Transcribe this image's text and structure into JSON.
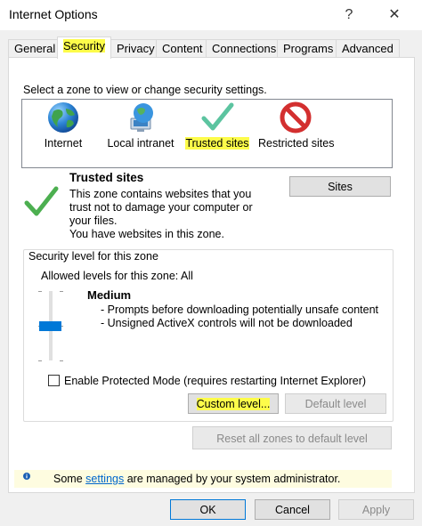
{
  "window": {
    "title": "Internet Options",
    "help_glyph": "?",
    "close_glyph": "✕"
  },
  "tabs": [
    {
      "label": "General"
    },
    {
      "label": "Security"
    },
    {
      "label": "Privacy"
    },
    {
      "label": "Content"
    },
    {
      "label": "Connections"
    },
    {
      "label": "Programs"
    },
    {
      "label": "Advanced"
    }
  ],
  "security": {
    "zone_prompt": "Select a zone to view or change security settings.",
    "zones": [
      {
        "label": "Internet",
        "icon": "globe-icon"
      },
      {
        "label": "Local intranet",
        "icon": "intranet-icon"
      },
      {
        "label": "Trusted sites",
        "icon": "checkmark-icon"
      },
      {
        "label": "Restricted sites",
        "icon": "restricted-icon"
      }
    ],
    "selected_zone": {
      "title": "Trusted sites",
      "description_lines": [
        "This zone contains websites that you",
        "trust not to damage your computer or",
        "your files.",
        "You have websites in this zone."
      ],
      "sites_button": "Sites"
    },
    "level_group": {
      "legend": "Security level for this zone",
      "allowed_levels": "Allowed levels for this zone: All",
      "level_name": "Medium",
      "level_details": [
        "- Prompts before downloading potentially unsafe content",
        "- Unsigned ActiveX controls will not be downloaded"
      ],
      "protected_mode_label": "Enable Protected Mode (requires restarting Internet Explorer)",
      "protected_mode_checked": false,
      "custom_level_button": "Custom level...",
      "default_level_button": "Default level"
    },
    "reset_all_button": "Reset all zones to default level",
    "info": {
      "prefix": "Some ",
      "link": "settings",
      "suffix": " are managed by your system administrator."
    }
  },
  "footer": {
    "ok": "OK",
    "cancel": "Cancel",
    "apply": "Apply"
  },
  "colors": {
    "highlight": "#fdfc4a",
    "accent": "#0078d7",
    "check_green": "#4caf50",
    "restricted_red": "#d32f2f"
  }
}
